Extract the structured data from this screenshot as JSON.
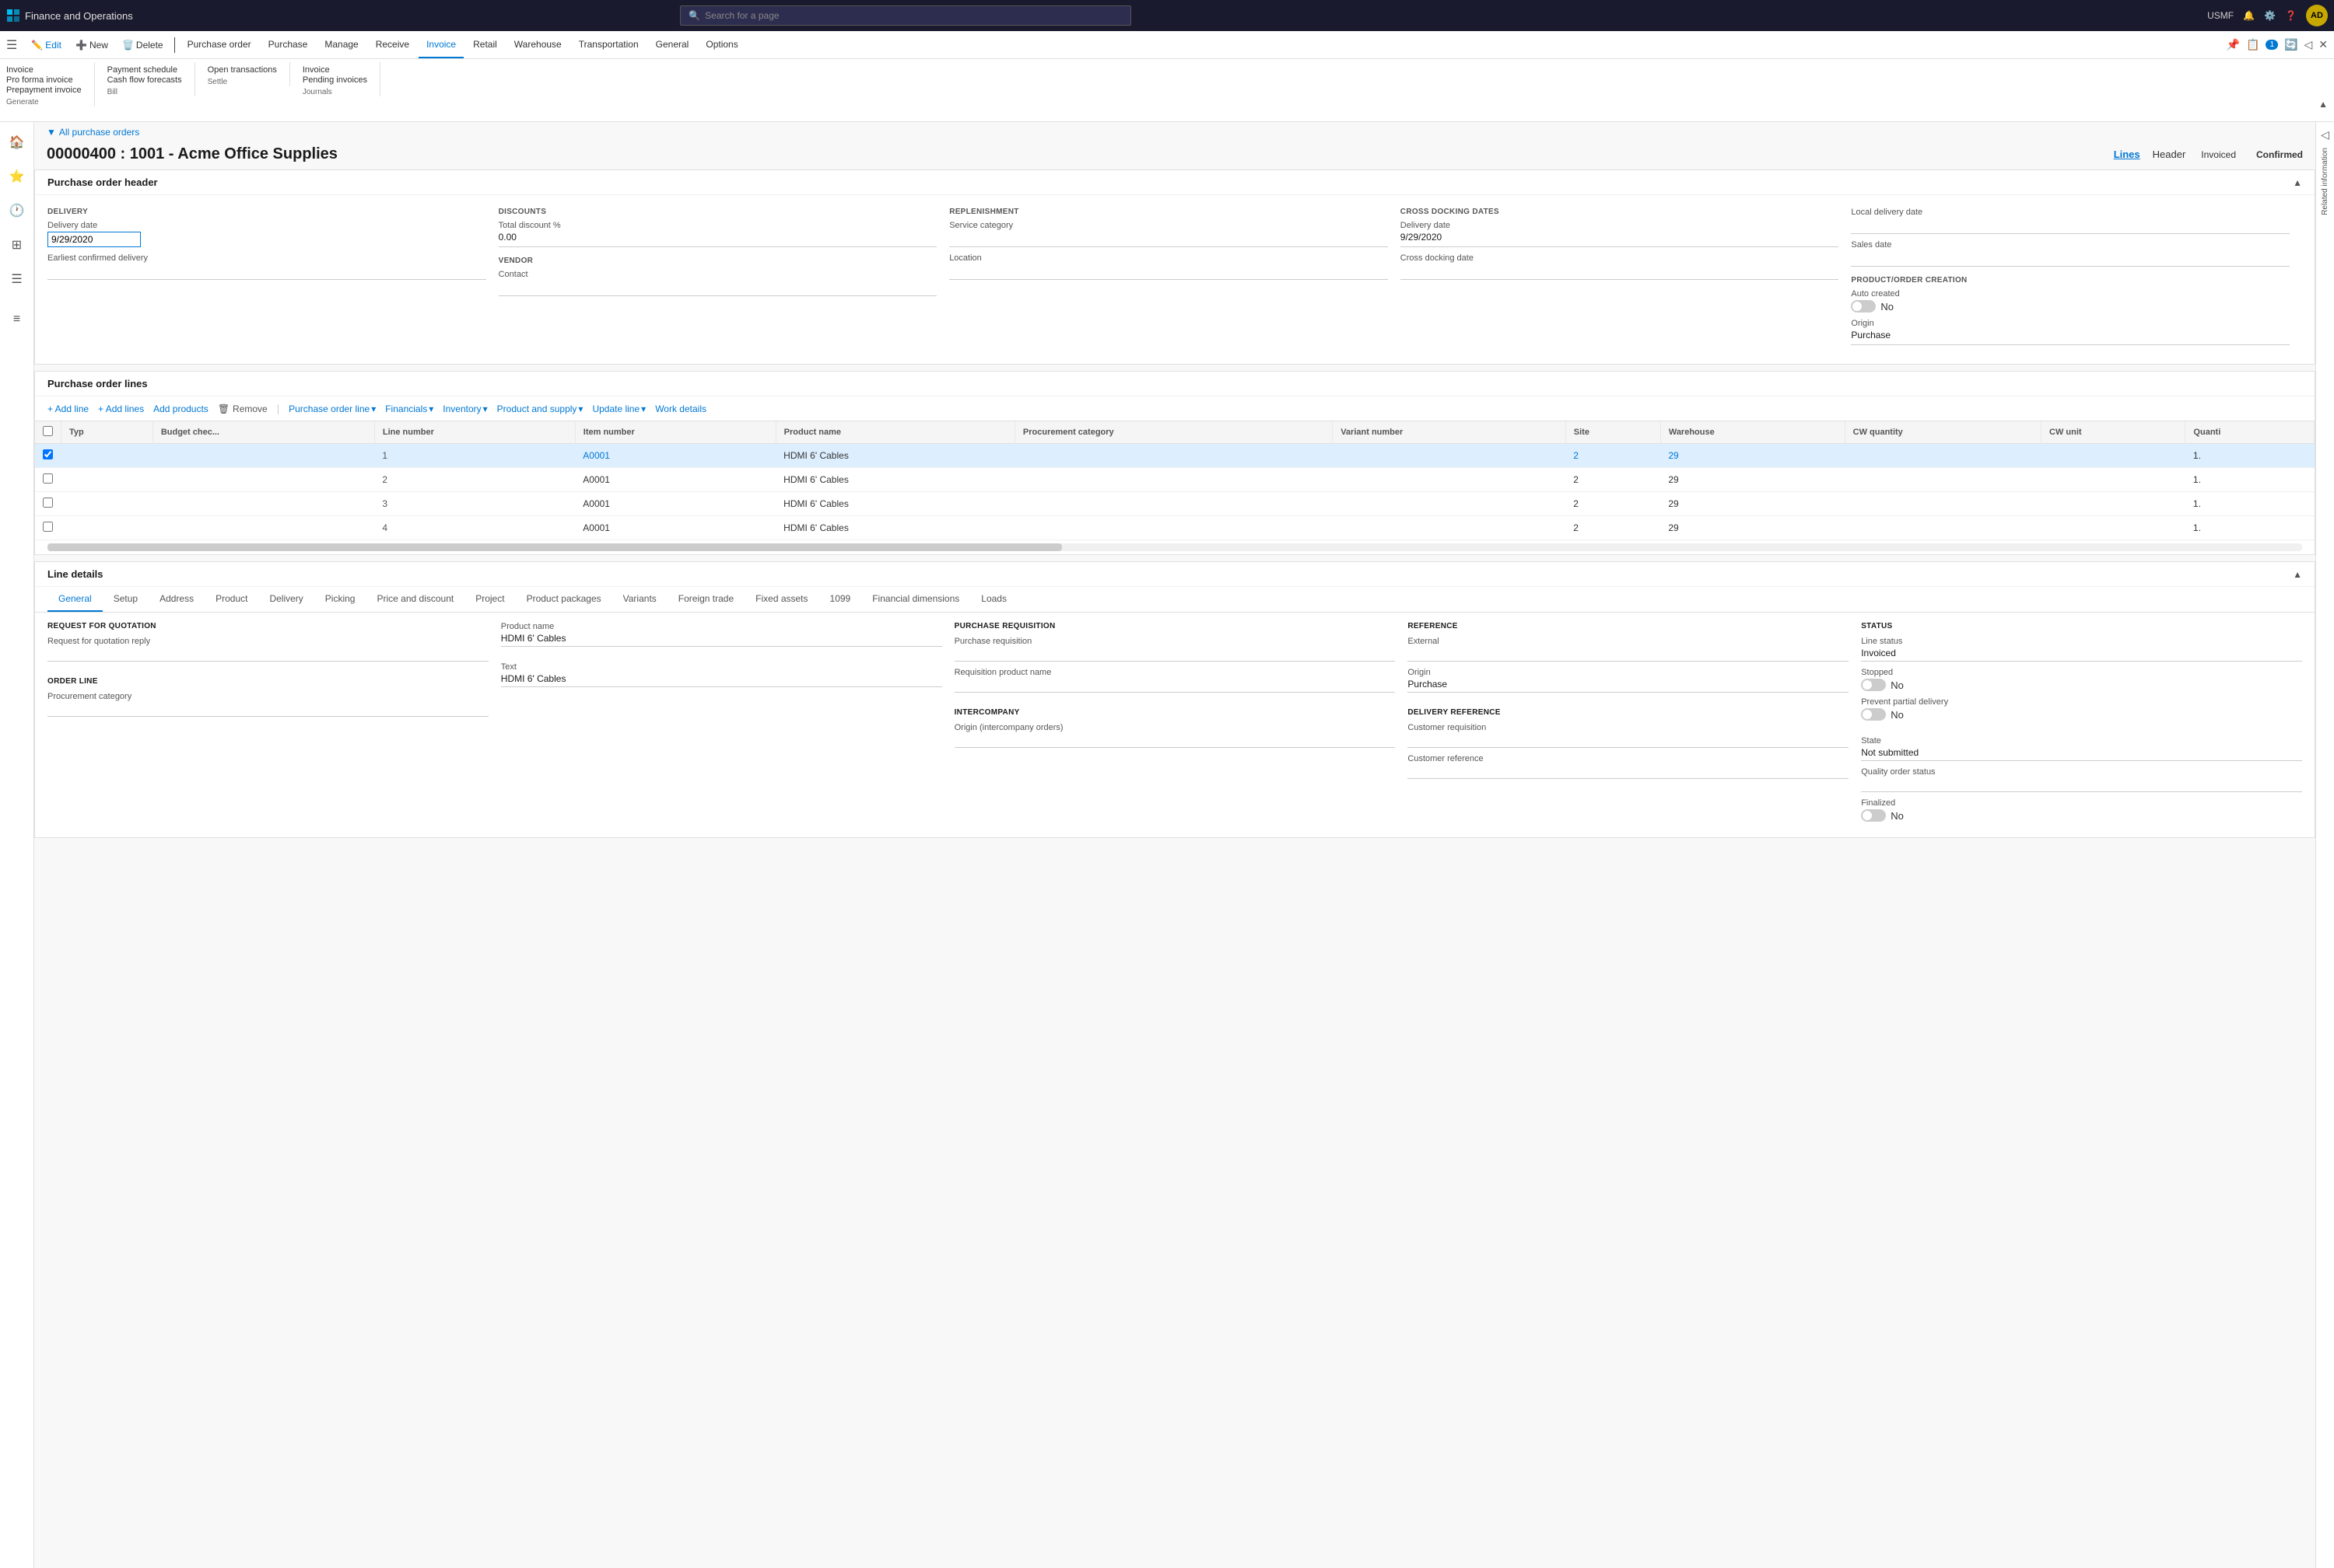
{
  "app": {
    "name": "Finance and Operations",
    "user": "USMF",
    "user_initials": "AD",
    "search_placeholder": "Search for a page"
  },
  "ribbon": {
    "tabs": [
      {
        "label": "Edit",
        "icon": "✏️",
        "active": false
      },
      {
        "label": "New",
        "active": false
      },
      {
        "label": "Delete",
        "active": false
      },
      {
        "label": "Purchase order",
        "active": false
      },
      {
        "label": "Purchase",
        "active": false
      },
      {
        "label": "Manage",
        "active": false
      },
      {
        "label": "Receive",
        "active": false
      },
      {
        "label": "Invoice",
        "active": true
      },
      {
        "label": "Retail",
        "active": false
      },
      {
        "label": "Warehouse",
        "active": false
      },
      {
        "label": "Transportation",
        "active": false
      },
      {
        "label": "General",
        "active": false
      },
      {
        "label": "Options",
        "active": false
      }
    ],
    "groups": [
      {
        "title": "Generate",
        "items": [
          {
            "label": "Invoice",
            "disabled": false
          },
          {
            "label": "Pro forma invoice",
            "disabled": false
          },
          {
            "label": "Prepayment invoice",
            "disabled": false
          }
        ]
      },
      {
        "title": "Bill",
        "items": [
          {
            "label": "Payment schedule",
            "disabled": false
          },
          {
            "label": "Cash flow forecasts",
            "disabled": false
          }
        ]
      },
      {
        "title": "Settle",
        "items": [
          {
            "label": "Open transactions",
            "disabled": false
          }
        ]
      },
      {
        "title": "Journals",
        "items": [
          {
            "label": "Invoice",
            "disabled": false
          },
          {
            "label": "Pending invoices",
            "disabled": false
          }
        ]
      }
    ]
  },
  "breadcrumb": {
    "text": "All purchase orders",
    "filter_icon": "▼"
  },
  "page": {
    "title": "00000400 : 1001 - Acme Office Supplies",
    "nav_lines": "Lines",
    "nav_header": "Header",
    "status_invoiced": "Invoiced",
    "status_confirmed": "Confirmed"
  },
  "purchase_order_header": {
    "section_title": "Purchase order header",
    "delivery": {
      "label": "DELIVERY",
      "delivery_date_label": "Delivery date",
      "delivery_date_value": "9/29/2020",
      "earliest_confirmed_label": "Earliest confirmed delivery"
    },
    "discounts": {
      "label": "DISCOUNTS",
      "total_discount_label": "Total discount %",
      "total_discount_value": "0.00"
    },
    "replenishment": {
      "label": "REPLENISHMENT",
      "service_category_label": "Service category",
      "location_label": "Location"
    },
    "cross_docking": {
      "label": "CROSS DOCKING DATES",
      "delivery_date_label": "Delivery date",
      "delivery_date_value": "9/29/2020",
      "cross_docking_label": "Cross docking date"
    },
    "local_delivery": {
      "label": "Local delivery date",
      "sales_date_label": "Sales date"
    },
    "product_order": {
      "label": "PRODUCT/ORDER CREATION",
      "auto_created_label": "Auto created",
      "auto_created_value": "No",
      "origin_label": "Origin",
      "origin_value": "Purchase"
    },
    "vendor": {
      "label": "VENDOR",
      "contact_label": "Contact"
    }
  },
  "purchase_order_lines": {
    "section_title": "Purchase order lines",
    "toolbar": {
      "add_line": "+ Add line",
      "add_lines": "+ Add lines",
      "add_products": "Add products",
      "remove": "Remove",
      "purchase_order_line": "Purchase order line",
      "financials": "Financials",
      "inventory": "Inventory",
      "product_and_supply": "Product and supply",
      "update_line": "Update line",
      "work_details": "Work details"
    },
    "columns": [
      "",
      "Typ",
      "Budget chec...",
      "Line number",
      "Item number",
      "Product name",
      "Procurement category",
      "Variant number",
      "Site",
      "Warehouse",
      "CW quantity",
      "CW unit",
      "Quanti"
    ],
    "rows": [
      {
        "typ": "",
        "budget": "",
        "line_number": "1",
        "item_number": "A0001",
        "product_name": "HDMI 6' Cables",
        "procurement": "",
        "variant": "",
        "site": "2",
        "warehouse": "29",
        "cw_qty": "",
        "cw_unit": "",
        "quantity": "1.",
        "selected": true
      },
      {
        "typ": "",
        "budget": "",
        "line_number": "2",
        "item_number": "A0001",
        "product_name": "HDMI 6' Cables",
        "procurement": "",
        "variant": "",
        "site": "2",
        "warehouse": "29",
        "cw_qty": "",
        "cw_unit": "",
        "quantity": "1.",
        "selected": false
      },
      {
        "typ": "",
        "budget": "",
        "line_number": "3",
        "item_number": "A0001",
        "product_name": "HDMI 6' Cables",
        "procurement": "",
        "variant": "",
        "site": "2",
        "warehouse": "29",
        "cw_qty": "",
        "cw_unit": "",
        "quantity": "1.",
        "selected": false
      },
      {
        "typ": "",
        "budget": "",
        "line_number": "4",
        "item_number": "A0001",
        "product_name": "HDMI 6' Cables",
        "procurement": "",
        "variant": "",
        "site": "2",
        "warehouse": "29",
        "cw_qty": "",
        "cw_unit": "",
        "quantity": "1.",
        "selected": false
      }
    ]
  },
  "line_details": {
    "section_title": "Line details",
    "tabs": [
      "General",
      "Setup",
      "Address",
      "Product",
      "Delivery",
      "Picking",
      "Price and discount",
      "Project",
      "Product packages",
      "Variants",
      "Foreign trade",
      "Fixed assets",
      "1099",
      "Financial dimensions",
      "Loads"
    ],
    "active_tab": "General",
    "request_for_quotation": {
      "title": "REQUEST FOR QUOTATION",
      "subtitle": "Request for quotation reply"
    },
    "order_line": {
      "title": "ORDER LINE",
      "procurement_label": "Procurement category"
    },
    "product_name": {
      "label": "Product name",
      "value": "HDMI 6' Cables"
    },
    "text": {
      "label": "Text",
      "value": "HDMI 6' Cables"
    },
    "purchase_requisition": {
      "title": "PURCHASE REQUISITION",
      "purchase_requisition_label": "Purchase requisition",
      "requisition_product_label": "Requisition product name"
    },
    "intercompany": {
      "title": "INTERCOMPANY",
      "origin_label": "Origin (intercompany orders)"
    },
    "reference": {
      "title": "REFERENCE",
      "external_label": "External",
      "origin_label": "Origin",
      "origin_value": "Purchase"
    },
    "delivery_reference": {
      "title": "DELIVERY REFERENCE",
      "customer_requisition_label": "Customer requisition",
      "customer_reference_label": "Customer reference"
    },
    "status": {
      "title": "STATUS",
      "line_status_label": "Line status",
      "line_status_value": "Invoiced",
      "stopped_label": "Stopped",
      "stopped_value": "No",
      "prevent_partial_label": "Prevent partial delivery",
      "prevent_partial_value": "No"
    },
    "state": {
      "label": "State",
      "value": "Not submitted",
      "quality_order_label": "Quality order status",
      "finalized_label": "Finalized",
      "finalized_value": "No"
    }
  },
  "right_panel": {
    "label": "Related information"
  }
}
